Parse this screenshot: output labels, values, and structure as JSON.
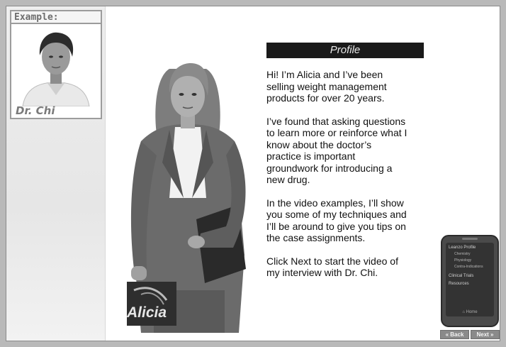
{
  "example": {
    "label": "Example:",
    "name": "Dr. Chi"
  },
  "character": {
    "name_logo": "Alicia"
  },
  "profile": {
    "title": "Profile",
    "paragraphs": [
      "Hi! I’m Alicia and I’ve been selling weight management products for over 20 years.",
      "I’ve found that asking questions to learn more or reinforce what I know about the doctor’s practice is important groundwork for introducing a new drug.",
      "In the video examples, I’ll show you some of my techniques and I’ll be around to give you tips on the case assignments.",
      "Click Next to start the video of my interview with Dr. Chi."
    ]
  },
  "device_menu": {
    "items": [
      {
        "label": "Leanzo Profile"
      },
      {
        "label": "Chemistry"
      },
      {
        "label": "Physiology"
      },
      {
        "label": "Contra-Indications"
      },
      {
        "label": "Clinical Trials"
      },
      {
        "label": "Resources"
      }
    ],
    "home_label": "Home"
  },
  "nav": {
    "back_label": "« Back",
    "next_label": "Next »"
  },
  "colors": {
    "header_bg": "#1a1a1a",
    "page_bg": "#ffffff",
    "side_panel": "#eeeeee"
  }
}
